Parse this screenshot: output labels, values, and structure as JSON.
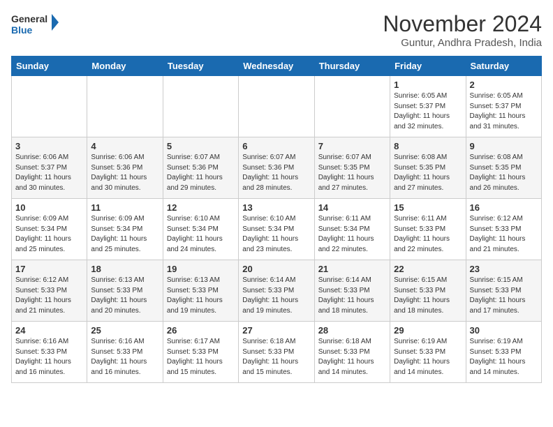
{
  "header": {
    "logo_line1": "General",
    "logo_line2": "Blue",
    "month": "November 2024",
    "location": "Guntur, Andhra Pradesh, India"
  },
  "weekdays": [
    "Sunday",
    "Monday",
    "Tuesday",
    "Wednesday",
    "Thursday",
    "Friday",
    "Saturday"
  ],
  "weeks": [
    [
      {
        "day": "",
        "info": ""
      },
      {
        "day": "",
        "info": ""
      },
      {
        "day": "",
        "info": ""
      },
      {
        "day": "",
        "info": ""
      },
      {
        "day": "",
        "info": ""
      },
      {
        "day": "1",
        "info": "Sunrise: 6:05 AM\nSunset: 5:37 PM\nDaylight: 11 hours\nand 32 minutes."
      },
      {
        "day": "2",
        "info": "Sunrise: 6:05 AM\nSunset: 5:37 PM\nDaylight: 11 hours\nand 31 minutes."
      }
    ],
    [
      {
        "day": "3",
        "info": "Sunrise: 6:06 AM\nSunset: 5:37 PM\nDaylight: 11 hours\nand 30 minutes."
      },
      {
        "day": "4",
        "info": "Sunrise: 6:06 AM\nSunset: 5:36 PM\nDaylight: 11 hours\nand 30 minutes."
      },
      {
        "day": "5",
        "info": "Sunrise: 6:07 AM\nSunset: 5:36 PM\nDaylight: 11 hours\nand 29 minutes."
      },
      {
        "day": "6",
        "info": "Sunrise: 6:07 AM\nSunset: 5:36 PM\nDaylight: 11 hours\nand 28 minutes."
      },
      {
        "day": "7",
        "info": "Sunrise: 6:07 AM\nSunset: 5:35 PM\nDaylight: 11 hours\nand 27 minutes."
      },
      {
        "day": "8",
        "info": "Sunrise: 6:08 AM\nSunset: 5:35 PM\nDaylight: 11 hours\nand 27 minutes."
      },
      {
        "day": "9",
        "info": "Sunrise: 6:08 AM\nSunset: 5:35 PM\nDaylight: 11 hours\nand 26 minutes."
      }
    ],
    [
      {
        "day": "10",
        "info": "Sunrise: 6:09 AM\nSunset: 5:34 PM\nDaylight: 11 hours\nand 25 minutes."
      },
      {
        "day": "11",
        "info": "Sunrise: 6:09 AM\nSunset: 5:34 PM\nDaylight: 11 hours\nand 25 minutes."
      },
      {
        "day": "12",
        "info": "Sunrise: 6:10 AM\nSunset: 5:34 PM\nDaylight: 11 hours\nand 24 minutes."
      },
      {
        "day": "13",
        "info": "Sunrise: 6:10 AM\nSunset: 5:34 PM\nDaylight: 11 hours\nand 23 minutes."
      },
      {
        "day": "14",
        "info": "Sunrise: 6:11 AM\nSunset: 5:34 PM\nDaylight: 11 hours\nand 22 minutes."
      },
      {
        "day": "15",
        "info": "Sunrise: 6:11 AM\nSunset: 5:33 PM\nDaylight: 11 hours\nand 22 minutes."
      },
      {
        "day": "16",
        "info": "Sunrise: 6:12 AM\nSunset: 5:33 PM\nDaylight: 11 hours\nand 21 minutes."
      }
    ],
    [
      {
        "day": "17",
        "info": "Sunrise: 6:12 AM\nSunset: 5:33 PM\nDaylight: 11 hours\nand 21 minutes."
      },
      {
        "day": "18",
        "info": "Sunrise: 6:13 AM\nSunset: 5:33 PM\nDaylight: 11 hours\nand 20 minutes."
      },
      {
        "day": "19",
        "info": "Sunrise: 6:13 AM\nSunset: 5:33 PM\nDaylight: 11 hours\nand 19 minutes."
      },
      {
        "day": "20",
        "info": "Sunrise: 6:14 AM\nSunset: 5:33 PM\nDaylight: 11 hours\nand 19 minutes."
      },
      {
        "day": "21",
        "info": "Sunrise: 6:14 AM\nSunset: 5:33 PM\nDaylight: 11 hours\nand 18 minutes."
      },
      {
        "day": "22",
        "info": "Sunrise: 6:15 AM\nSunset: 5:33 PM\nDaylight: 11 hours\nand 18 minutes."
      },
      {
        "day": "23",
        "info": "Sunrise: 6:15 AM\nSunset: 5:33 PM\nDaylight: 11 hours\nand 17 minutes."
      }
    ],
    [
      {
        "day": "24",
        "info": "Sunrise: 6:16 AM\nSunset: 5:33 PM\nDaylight: 11 hours\nand 16 minutes."
      },
      {
        "day": "25",
        "info": "Sunrise: 6:16 AM\nSunset: 5:33 PM\nDaylight: 11 hours\nand 16 minutes."
      },
      {
        "day": "26",
        "info": "Sunrise: 6:17 AM\nSunset: 5:33 PM\nDaylight: 11 hours\nand 15 minutes."
      },
      {
        "day": "27",
        "info": "Sunrise: 6:18 AM\nSunset: 5:33 PM\nDaylight: 11 hours\nand 15 minutes."
      },
      {
        "day": "28",
        "info": "Sunrise: 6:18 AM\nSunset: 5:33 PM\nDaylight: 11 hours\nand 14 minutes."
      },
      {
        "day": "29",
        "info": "Sunrise: 6:19 AM\nSunset: 5:33 PM\nDaylight: 11 hours\nand 14 minutes."
      },
      {
        "day": "30",
        "info": "Sunrise: 6:19 AM\nSunset: 5:33 PM\nDaylight: 11 hours\nand 14 minutes."
      }
    ]
  ]
}
